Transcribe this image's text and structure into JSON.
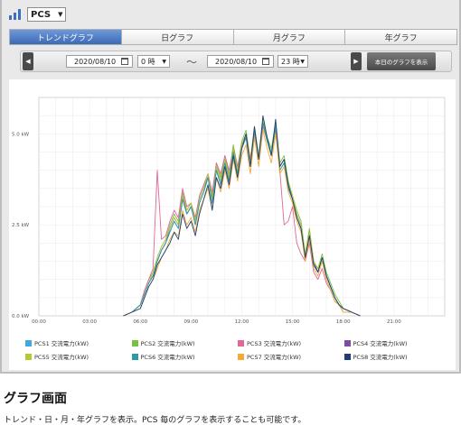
{
  "header": {
    "graph_icon": "bar-chart-icon",
    "device_select": "PCS"
  },
  "tabs": [
    {
      "label": "トレンドグラフ",
      "active": true
    },
    {
      "label": "日グラフ",
      "active": false
    },
    {
      "label": "月グラフ",
      "active": false
    },
    {
      "label": "年グラフ",
      "active": false
    }
  ],
  "range": {
    "prev_icon": "chevron-left-icon",
    "next_icon": "chevron-right-icon",
    "start_date": "2020/08/10",
    "start_hour": "0 時",
    "separator": "〜",
    "end_date": "2020/08/10",
    "end_hour": "23 時",
    "today_button": "本日のグラフを表示"
  },
  "chart_data": {
    "type": "line",
    "ylabels": [
      "0.0 kW",
      "2.5 kW",
      "5.0 kW"
    ],
    "ylim": [
      0,
      6.0
    ],
    "xlabels": [
      "00:00",
      "03:00",
      "06:00",
      "09:00",
      "12:00",
      "15:00",
      "18:00",
      "21:00"
    ],
    "xlim": [
      0,
      24
    ],
    "grid": true,
    "legend_position": "bottom",
    "x": [
      5.0,
      5.5,
      6.0,
      6.25,
      6.5,
      6.75,
      7.0,
      7.25,
      7.5,
      7.75,
      8.0,
      8.25,
      8.5,
      8.75,
      9.0,
      9.25,
      9.5,
      9.75,
      10.0,
      10.25,
      10.5,
      10.75,
      11.0,
      11.25,
      11.5,
      11.75,
      12.0,
      12.25,
      12.5,
      12.75,
      13.0,
      13.25,
      13.5,
      13.75,
      14.0,
      14.25,
      14.5,
      14.75,
      15.0,
      15.25,
      15.5,
      15.75,
      16.0,
      16.25,
      16.5,
      16.75,
      17.0,
      17.25,
      17.5,
      17.75,
      18.0,
      18.5,
      19.0
    ],
    "series": [
      {
        "name": "PCS1 交流電力(kW)",
        "color": "#3fa9e0",
        "values": [
          0.0,
          0.1,
          0.3,
          0.6,
          0.9,
          1.1,
          1.5,
          1.8,
          2.0,
          2.3,
          2.6,
          2.4,
          3.2,
          2.8,
          3.0,
          2.5,
          3.1,
          3.4,
          3.8,
          3.1,
          4.0,
          3.6,
          4.2,
          3.7,
          4.5,
          3.9,
          4.6,
          4.9,
          4.1,
          5.1,
          4.3,
          5.3,
          4.8,
          4.4,
          5.2,
          4.0,
          4.2,
          3.5,
          3.2,
          2.7,
          2.4,
          1.6,
          2.2,
          1.4,
          1.2,
          1.6,
          1.1,
          0.8,
          0.5,
          0.3,
          0.2,
          0.1,
          0.0
        ]
      },
      {
        "name": "PCS2 交流電力(kW)",
        "color": "#7ac143",
        "values": [
          0.0,
          0.1,
          0.3,
          0.7,
          1.0,
          1.2,
          1.6,
          1.9,
          2.1,
          2.5,
          2.8,
          2.6,
          3.4,
          2.9,
          3.1,
          2.6,
          3.3,
          3.6,
          3.9,
          3.3,
          4.2,
          3.8,
          4.4,
          3.9,
          4.7,
          4.1,
          4.8,
          5.1,
          4.3,
          5.2,
          4.4,
          5.4,
          4.9,
          4.6,
          5.3,
          4.2,
          4.4,
          3.7,
          3.3,
          2.9,
          2.6,
          1.7,
          2.4,
          1.5,
          1.3,
          1.7,
          1.2,
          0.9,
          0.6,
          0.4,
          0.2,
          0.1,
          0.0
        ]
      },
      {
        "name": "PCS3 交流電力(kW)",
        "color": "#e0679a",
        "values": [
          0.0,
          0.1,
          0.3,
          0.7,
          1.0,
          1.3,
          4.0,
          2.1,
          2.2,
          2.6,
          2.9,
          2.7,
          3.5,
          3.0,
          3.1,
          2.7,
          3.3,
          3.6,
          3.9,
          3.4,
          4.2,
          3.9,
          4.4,
          4.0,
          4.6,
          4.1,
          4.7,
          5.0,
          4.3,
          5.0,
          4.4,
          5.2,
          4.8,
          4.5,
          5.1,
          4.0,
          2.5,
          2.6,
          3.0,
          2.0,
          1.7,
          1.5,
          2.0,
          1.2,
          1.0,
          1.3,
          0.9,
          0.7,
          0.4,
          0.3,
          0.1,
          0.1,
          0.0
        ]
      },
      {
        "name": "PCS4 交流電力(kW)",
        "color": "#7b4ea3",
        "values": [
          0.0,
          0.1,
          0.3,
          0.6,
          0.9,
          1.1,
          1.5,
          1.8,
          2.0,
          2.4,
          2.7,
          2.5,
          3.3,
          2.8,
          3.0,
          2.6,
          3.2,
          3.5,
          3.8,
          3.2,
          4.1,
          3.7,
          4.3,
          3.8,
          4.6,
          4.0,
          4.7,
          5.0,
          4.2,
          5.1,
          4.3,
          5.3,
          4.8,
          4.5,
          5.2,
          4.1,
          4.3,
          3.6,
          3.2,
          2.8,
          2.5,
          1.6,
          2.3,
          1.5,
          1.2,
          1.6,
          1.1,
          0.8,
          0.5,
          0.3,
          0.2,
          0.1,
          0.0
        ]
      },
      {
        "name": "PCS5 交流電力(kW)",
        "color": "#b8c832",
        "values": [
          0.0,
          0.1,
          0.3,
          0.6,
          0.9,
          1.2,
          1.6,
          1.9,
          2.1,
          2.4,
          2.7,
          2.5,
          3.3,
          2.9,
          3.1,
          2.6,
          3.2,
          3.5,
          3.9,
          3.2,
          4.1,
          3.7,
          4.3,
          3.8,
          4.6,
          4.0,
          4.7,
          5.0,
          4.2,
          5.1,
          4.4,
          5.3,
          4.8,
          4.5,
          5.2,
          4.1,
          4.3,
          3.6,
          3.3,
          2.8,
          2.5,
          1.7,
          2.3,
          1.5,
          1.3,
          1.6,
          1.1,
          0.8,
          0.5,
          0.3,
          0.2,
          0.1,
          0.0
        ]
      },
      {
        "name": "PCS6 交流電力(kW)",
        "color": "#2f9aa6",
        "values": [
          0.0,
          0.1,
          0.3,
          0.6,
          0.9,
          1.1,
          1.5,
          1.8,
          2.0,
          2.3,
          2.6,
          2.4,
          3.2,
          2.8,
          3.0,
          2.5,
          3.1,
          3.4,
          3.8,
          3.1,
          4.0,
          3.6,
          4.2,
          3.7,
          4.5,
          3.9,
          4.6,
          4.9,
          4.1,
          5.1,
          4.3,
          5.3,
          4.8,
          4.4,
          5.2,
          4.0,
          4.2,
          3.5,
          3.2,
          2.7,
          2.4,
          1.6,
          2.2,
          1.4,
          1.2,
          1.6,
          1.1,
          0.8,
          0.5,
          0.3,
          0.2,
          0.1,
          0.0
        ]
      },
      {
        "name": "PCS7 交流電力(kW)",
        "color": "#f5a93a",
        "values": [
          0.0,
          0.1,
          0.2,
          0.5,
          0.8,
          1.0,
          1.3,
          1.6,
          1.8,
          2.1,
          2.3,
          2.2,
          2.9,
          2.5,
          2.7,
          2.3,
          2.9,
          3.2,
          3.5,
          2.9,
          3.8,
          3.4,
          4.0,
          3.5,
          4.3,
          3.7,
          4.4,
          4.7,
          3.9,
          4.9,
          4.1,
          5.1,
          4.6,
          4.2,
          5.0,
          3.9,
          4.1,
          3.4,
          3.1,
          2.6,
          2.3,
          1.5,
          2.1,
          1.3,
          1.1,
          1.5,
          1.0,
          0.7,
          0.4,
          0.3,
          0.1,
          0.1,
          0.0
        ]
      },
      {
        "name": "PCS8 交流電力(kW)",
        "color": "#1f3f73",
        "values": [
          0.0,
          0.1,
          0.2,
          0.5,
          0.8,
          1.0,
          1.4,
          1.6,
          1.8,
          2.0,
          2.3,
          2.1,
          2.8,
          2.4,
          2.6,
          2.2,
          2.8,
          3.2,
          3.6,
          2.9,
          3.8,
          3.5,
          4.1,
          3.6,
          4.4,
          3.8,
          4.6,
          5.0,
          4.1,
          5.2,
          4.3,
          5.5,
          4.9,
          4.4,
          5.4,
          4.1,
          4.3,
          3.6,
          3.2,
          2.7,
          2.4,
          1.6,
          2.2,
          1.4,
          1.2,
          1.6,
          1.1,
          0.8,
          0.5,
          0.3,
          0.2,
          0.1,
          0.0
        ]
      }
    ]
  },
  "caption": {
    "title": "グラフ画面",
    "text": "トレンド・日・月・年グラフを表示。PCS 毎のグラフを表示することも可能です。"
  }
}
